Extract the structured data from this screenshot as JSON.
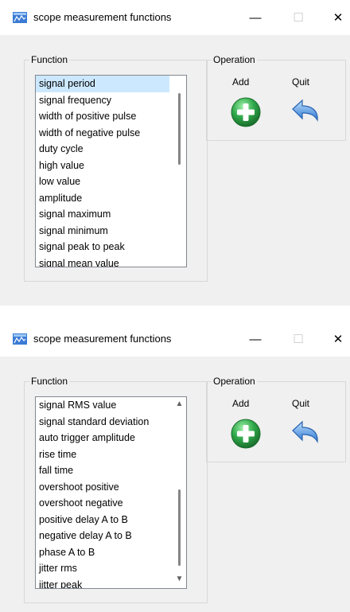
{
  "windows": [
    {
      "title": "scope measurement functions",
      "function_group_label": "Function",
      "operation_group_label": "Operation",
      "add_label": "Add",
      "quit_label": "Quit",
      "list_items": [
        "signal period",
        "signal frequency",
        "width of positive pulse",
        "width of negative pulse",
        "duty cycle",
        "high value",
        "low value",
        "amplitude",
        "signal maximum",
        "signal minimum",
        "signal peak to peak",
        "signal mean value"
      ],
      "selected_item": "signal period"
    },
    {
      "title": "scope measurement functions",
      "function_group_label": "Function",
      "operation_group_label": "Operation",
      "add_label": "Add",
      "quit_label": "Quit",
      "list_items": [
        "signal RMS value",
        "signal standard deviation",
        "auto trigger amplitude",
        "rise time",
        "fall time",
        "overshoot positive",
        "overshoot negative",
        "positive delay A to B",
        "negative delay A to B",
        "phase A to B",
        "jitter rms",
        "jitter peak"
      ]
    }
  ],
  "colors": {
    "selection": "#cce8ff",
    "add_icon_green": "#2fa84a",
    "quit_icon_blue": "#3f8fe0"
  },
  "icons": [
    "app-icon",
    "minimize-icon",
    "maximize-icon",
    "close-icon",
    "add-icon",
    "quit-icon"
  ]
}
